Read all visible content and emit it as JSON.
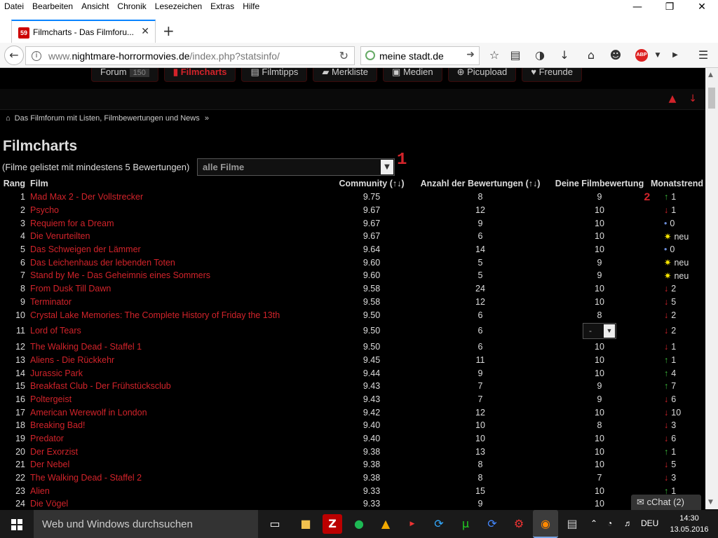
{
  "menubar": {
    "items": [
      "Datei",
      "Bearbeiten",
      "Ansicht",
      "Chronik",
      "Lesezeichen",
      "Extras",
      "Hilfe"
    ]
  },
  "tab": {
    "favicon_text": "59",
    "title": "Filmcharts - Das Filmforu..."
  },
  "navbar": {
    "url_plain": "www.",
    "url_domain": "nightmare-horrormovies.de",
    "url_path": "/index.php?statsinfo/",
    "search_text": "meine stadt.de",
    "abp_label": "ABP"
  },
  "sitenav": {
    "items": [
      {
        "icon": "",
        "label": "Forum",
        "count": "150"
      },
      {
        "icon": "▮",
        "label": "Filmcharts"
      },
      {
        "icon": "▤",
        "label": "Filmtipps"
      },
      {
        "icon": "▰",
        "label": "Merkliste"
      },
      {
        "icon": "▣",
        "label": "Medien"
      },
      {
        "icon": "⊕",
        "label": "Picupload"
      },
      {
        "icon": "♥",
        "label": "Freunde"
      }
    ]
  },
  "breadcrumb": {
    "text": "Das Filmforum mit Listen, Filmbewertungen und News",
    "sep": "»"
  },
  "page": {
    "title": "Filmcharts",
    "filter_label": "(Filme gelistet mit mindestens 5 Bewertungen)",
    "filter_value": "alle Filme",
    "marker_1": "1",
    "marker_2": "2"
  },
  "table": {
    "headers": {
      "rank": "Rang",
      "film": "Film",
      "community": "Community (↑↓)",
      "count": "Anzahl der Bewertungen (↑↓)",
      "mine": "Deine Filmbewertung",
      "trend": "Monatstrend"
    },
    "rows": [
      {
        "rank": "1",
        "film": "Mad Max 2 - Der Vollstrecker",
        "community": "9.75",
        "count": "8",
        "mine": "9",
        "trend_symbol": "↑",
        "trend_type": "up",
        "trend_value": "1"
      },
      {
        "rank": "2",
        "film": "Psycho",
        "community": "9.67",
        "count": "12",
        "mine": "10",
        "trend_symbol": "↓",
        "trend_type": "down",
        "trend_value": "1"
      },
      {
        "rank": "3",
        "film": "Requiem for a Dream",
        "community": "9.67",
        "count": "9",
        "mine": "10",
        "trend_symbol": "•",
        "trend_type": "dot",
        "trend_value": "0"
      },
      {
        "rank": "4",
        "film": "Die Verurteilten",
        "community": "9.67",
        "count": "6",
        "mine": "10",
        "trend_symbol": "✷",
        "trend_type": "new",
        "trend_value": "neu"
      },
      {
        "rank": "5",
        "film": "Das Schweigen der Lämmer",
        "community": "9.64",
        "count": "14",
        "mine": "10",
        "trend_symbol": "•",
        "trend_type": "dot",
        "trend_value": "0"
      },
      {
        "rank": "6",
        "film": "Das Leichenhaus der lebenden Toten",
        "community": "9.60",
        "count": "5",
        "mine": "9",
        "trend_symbol": "✷",
        "trend_type": "new",
        "trend_value": "neu"
      },
      {
        "rank": "7",
        "film": "Stand by Me - Das Geheimnis eines Sommers",
        "community": "9.60",
        "count": "5",
        "mine": "9",
        "trend_symbol": "✷",
        "trend_type": "new",
        "trend_value": "neu"
      },
      {
        "rank": "8",
        "film": "From Dusk Till Dawn",
        "community": "9.58",
        "count": "24",
        "mine": "10",
        "trend_symbol": "↓",
        "trend_type": "down",
        "trend_value": "2"
      },
      {
        "rank": "9",
        "film": "Terminator",
        "community": "9.58",
        "count": "12",
        "mine": "10",
        "trend_symbol": "↓",
        "trend_type": "down",
        "trend_value": "5"
      },
      {
        "rank": "10",
        "film": "Crystal Lake Memories: The Complete History of Friday the 13th",
        "community": "9.50",
        "count": "6",
        "mine": "8",
        "trend_symbol": "↓",
        "trend_type": "down",
        "trend_value": "2"
      },
      {
        "rank": "11",
        "film": "Lord of Tears",
        "community": "9.50",
        "count": "6",
        "mine": "",
        "mine_select": "-",
        "trend_symbol": "↓",
        "trend_type": "down",
        "trend_value": "2"
      },
      {
        "rank": "12",
        "film": "The Walking Dead - Staffel 1",
        "community": "9.50",
        "count": "6",
        "mine": "10",
        "trend_symbol": "↓",
        "trend_type": "down",
        "trend_value": "1"
      },
      {
        "rank": "13",
        "film": "Aliens - Die Rückkehr",
        "community": "9.45",
        "count": "11",
        "mine": "10",
        "trend_symbol": "↑",
        "trend_type": "up",
        "trend_value": "1"
      },
      {
        "rank": "14",
        "film": "Jurassic Park",
        "community": "9.44",
        "count": "9",
        "mine": "10",
        "trend_symbol": "↑",
        "trend_type": "up",
        "trend_value": "4"
      },
      {
        "rank": "15",
        "film": "Breakfast Club - Der Frühstücksclub",
        "community": "9.43",
        "count": "7",
        "mine": "9",
        "trend_symbol": "↑",
        "trend_type": "up",
        "trend_value": "7"
      },
      {
        "rank": "16",
        "film": "Poltergeist",
        "community": "9.43",
        "count": "7",
        "mine": "9",
        "trend_symbol": "↓",
        "trend_type": "down",
        "trend_value": "6"
      },
      {
        "rank": "17",
        "film": "American Werewolf in London",
        "community": "9.42",
        "count": "12",
        "mine": "10",
        "trend_symbol": "↓",
        "trend_type": "down",
        "trend_value": "10"
      },
      {
        "rank": "18",
        "film": "Breaking Bad!",
        "community": "9.40",
        "count": "10",
        "mine": "8",
        "trend_symbol": "↓",
        "trend_type": "down",
        "trend_value": "3"
      },
      {
        "rank": "19",
        "film": "Predator",
        "community": "9.40",
        "count": "10",
        "mine": "10",
        "trend_symbol": "↓",
        "trend_type": "down",
        "trend_value": "6"
      },
      {
        "rank": "20",
        "film": "Der Exorzist",
        "community": "9.38",
        "count": "13",
        "mine": "10",
        "trend_symbol": "↑",
        "trend_type": "up",
        "trend_value": "1"
      },
      {
        "rank": "21",
        "film": "Der Nebel",
        "community": "9.38",
        "count": "8",
        "mine": "10",
        "trend_symbol": "↓",
        "trend_type": "down",
        "trend_value": "5"
      },
      {
        "rank": "22",
        "film": "The Walking Dead - Staffel 2",
        "community": "9.38",
        "count": "8",
        "mine": "7",
        "trend_symbol": "↓",
        "trend_type": "down",
        "trend_value": "3"
      },
      {
        "rank": "23",
        "film": "Alien",
        "community": "9.33",
        "count": "15",
        "mine": "10",
        "trend_symbol": "↑",
        "trend_type": "up",
        "trend_value": "1"
      },
      {
        "rank": "24",
        "film": "Die Vögel",
        "community": "9.33",
        "count": "9",
        "mine": "10",
        "trend_symbol": "",
        "trend_type": "none",
        "trend_value": ""
      }
    ]
  },
  "cchat": {
    "label": "cChat (2)"
  },
  "taskbar": {
    "search_placeholder": "Web und Windows durchsuchen",
    "lang": "DEU",
    "time": "14:30",
    "date": "13.05.2016"
  },
  "colors": {
    "accent": "#d2232a",
    "trend_up": "#3bbb3b",
    "trend_down": "#d2232a",
    "trend_new": "#ffea00",
    "trend_dot": "#6a8bd6"
  }
}
